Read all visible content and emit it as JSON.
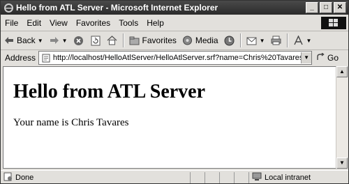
{
  "window": {
    "title": "Hello from ATL Server - Microsoft Internet Explorer"
  },
  "menu": [
    "File",
    "Edit",
    "View",
    "Favorites",
    "Tools",
    "Help"
  ],
  "toolbar": {
    "back_label": "Back",
    "favorites_label": "Favorites",
    "media_label": "Media"
  },
  "address": {
    "label": "Address",
    "url": "http://localhost/HelloAtlServer/HelloAtlServer.srf?name=Chris%20Tavares",
    "go_label": "Go"
  },
  "page": {
    "heading": "Hello from ATL Server",
    "text": "Your name is Chris Tavares"
  },
  "status": {
    "text": "Done",
    "zone": "Local intranet"
  }
}
